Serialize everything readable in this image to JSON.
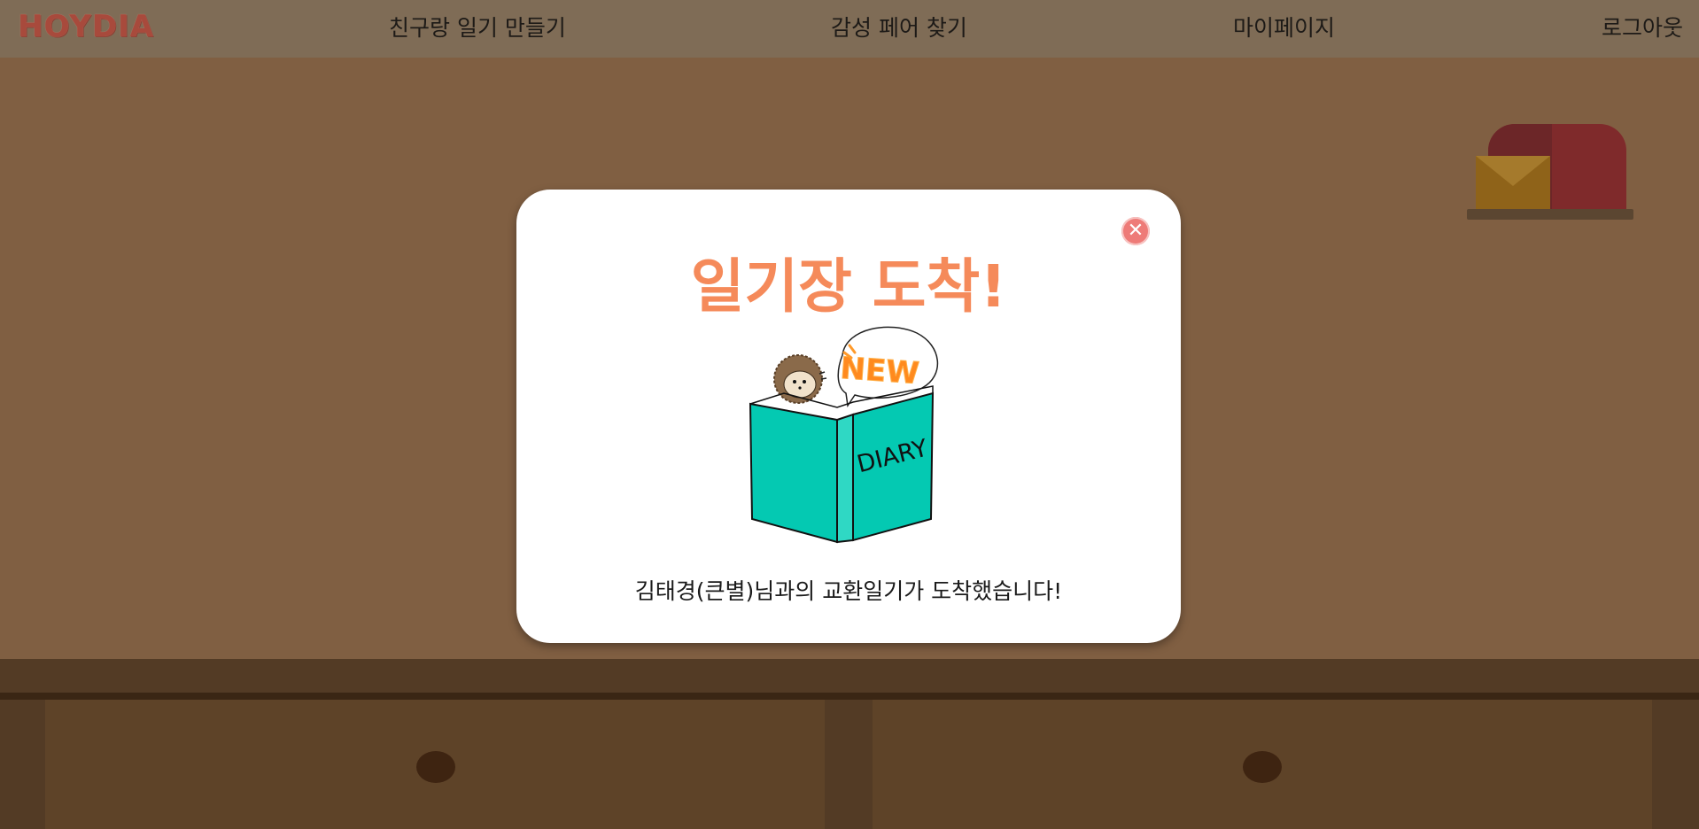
{
  "header": {
    "logo": "HOYDIA",
    "nav": [
      {
        "label": "친구랑 일기 만들기"
      },
      {
        "label": "감성 페어 찾기"
      },
      {
        "label": "마이페이지"
      },
      {
        "label": "로그아웃"
      }
    ]
  },
  "modal": {
    "title": "일기장 도착!",
    "close_icon": "close-icon",
    "illustration": {
      "badge": "NEW",
      "book_label": "DIARY"
    },
    "message": "김태경(큰별)님과의 교환일기가 도착했습니다!"
  },
  "colors": {
    "accent": "#f58a5a",
    "close": "#ee7b78",
    "book": "#04c9b2",
    "background": "#805f42",
    "header": "#7f6c56"
  }
}
